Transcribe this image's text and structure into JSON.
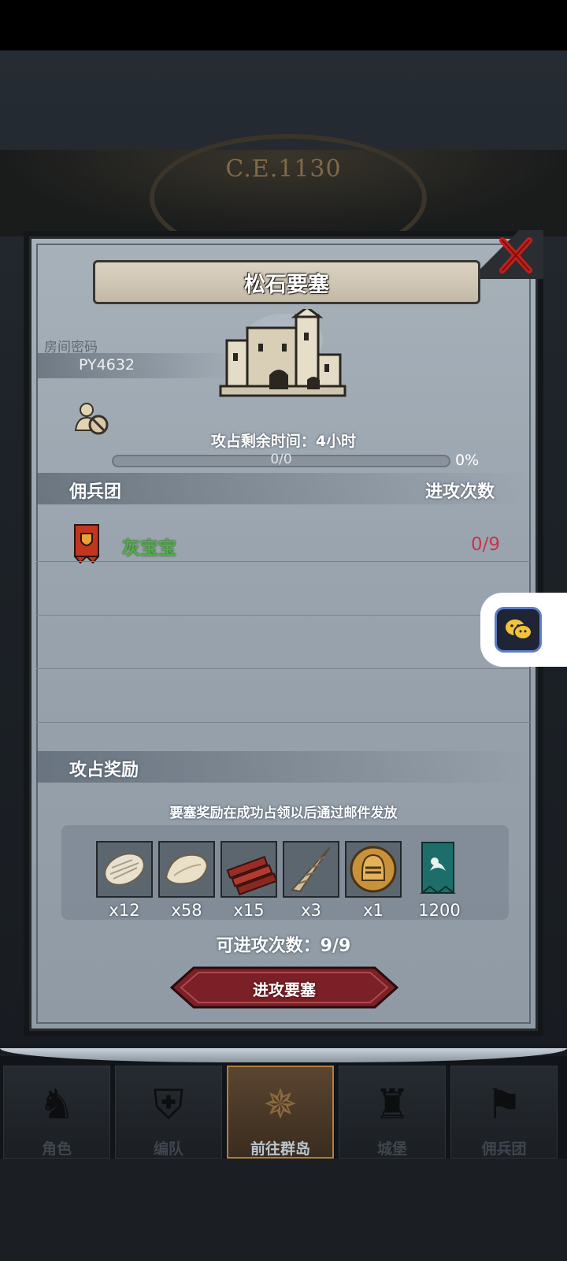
{
  "header": {
    "era_text": "C.E.1130"
  },
  "dialog": {
    "title": "松石要塞",
    "room_label": "房间密码",
    "room_code": "PY4632",
    "time_label": "攻占剩余时间：4小时",
    "progress": {
      "text": "0/0",
      "percent_text": "0%",
      "fraction": 0.0
    },
    "mercenary_header": "佣兵团",
    "attack_times_header": "进攻次数",
    "mercenaries": [
      {
        "name": "灰宝宝",
        "count": "0/9"
      }
    ],
    "reward_header": "攻占奖励",
    "reward_note": "要塞奖励在成功占领以后通过邮件发放",
    "rewards": [
      {
        "icon": "fur-pelt-icon",
        "qty": "x12"
      },
      {
        "icon": "leather-hide-icon",
        "qty": "x58"
      },
      {
        "icon": "wood-planks-icon",
        "qty": "x15"
      },
      {
        "icon": "horn-icon",
        "qty": "x3"
      },
      {
        "icon": "golden-helmet-icon",
        "qty": "x1"
      },
      {
        "icon": "guild-banner-icon",
        "qty": "1200"
      }
    ],
    "attack_count": "可进攻次数：9/9",
    "attack_button": "进攻要塞"
  },
  "nav": {
    "tabs": [
      {
        "label": "角色",
        "icon": "knight-icon",
        "active": false
      },
      {
        "label": "编队",
        "icon": "helmet-icon",
        "active": false
      },
      {
        "label": "前往群岛",
        "icon": "compass-icon",
        "active": true
      },
      {
        "label": "城堡",
        "icon": "castle-icon",
        "active": false
      },
      {
        "label": "佣兵团",
        "icon": "banner-icon",
        "active": false
      }
    ]
  },
  "colors": {
    "merc_name": "#4fb142",
    "attack_count_red": "#c8344a",
    "close_red": "#c0201c",
    "button_red": "#7a2026",
    "active_tab_gold": "#b07f3b"
  }
}
